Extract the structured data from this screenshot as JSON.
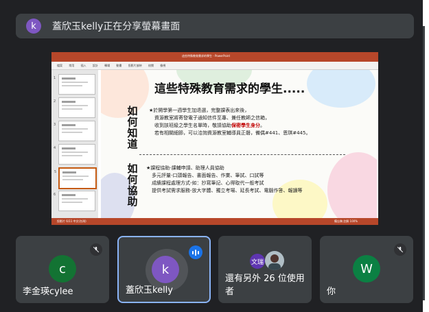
{
  "banner": {
    "avatar_letter": "k",
    "text": "蓋欣玉kelly正在分享螢幕畫面"
  },
  "presentation": {
    "window_title": "這些特殊教育需求的學生 - PowerPoint",
    "ribbon_tabs": [
      "檔案",
      "常用",
      "插入",
      "設計",
      "轉場",
      "動畫",
      "投影片放映",
      "校閱",
      "檢視"
    ],
    "thumb_numbers": [
      "1",
      "2",
      "3",
      "4",
      "5",
      "6"
    ],
    "slide": {
      "title": "這些特殊教育需求的學生.....",
      "section1_label": "如何知道",
      "section1_lines": [
        "★於開學第一週學生加退選，完整課表出來後，",
        "資源教室將寄發電子通知信件至專、兼任教師之信箱，",
        "收到該班級之學生名單時，敬請協助",
        "若有相關細節，可以洽詢資源教室輔導員正磐，備偶#441、恩琪#445。"
      ],
      "section1_red": "保密學生身分",
      "section1_after_red": "。",
      "section2_label": "如何協助",
      "section2_lines": [
        "★課程協助-課輔申請、助理人員協助",
        "多元評量-口頭報告、書面報告、作業、筆試、口試等",
        "成績課程處理方式-如：抄寫筆記、心得取代一般考試",
        "提供考試需求服務-放大字體、獨立考場、延長考試、電腦作答、報讀等"
      ]
    },
    "status_left": "投影片 6/11   中文(台灣)",
    "status_right": "備忘稿   註解   100%"
  },
  "tiles": [
    {
      "name": "李金瑛cylee",
      "avatar_letter": "c",
      "avatar_color": "#137333",
      "muted": true
    },
    {
      "name": "蓋欣玉kelly",
      "avatar_letter": "k",
      "avatar_color": "#7e57c2",
      "speaking": true
    },
    {
      "name": "還有另外 26 位使用者",
      "avatar_text": "文瑞",
      "avatar_color": "#5e35b1"
    },
    {
      "name": "你",
      "avatar_letter": "W",
      "avatar_color": "#0b8043",
      "muted": true
    }
  ],
  "icons": [
    "mic-off-icon",
    "speaking-indicator-icon",
    "user-photo-icon"
  ]
}
